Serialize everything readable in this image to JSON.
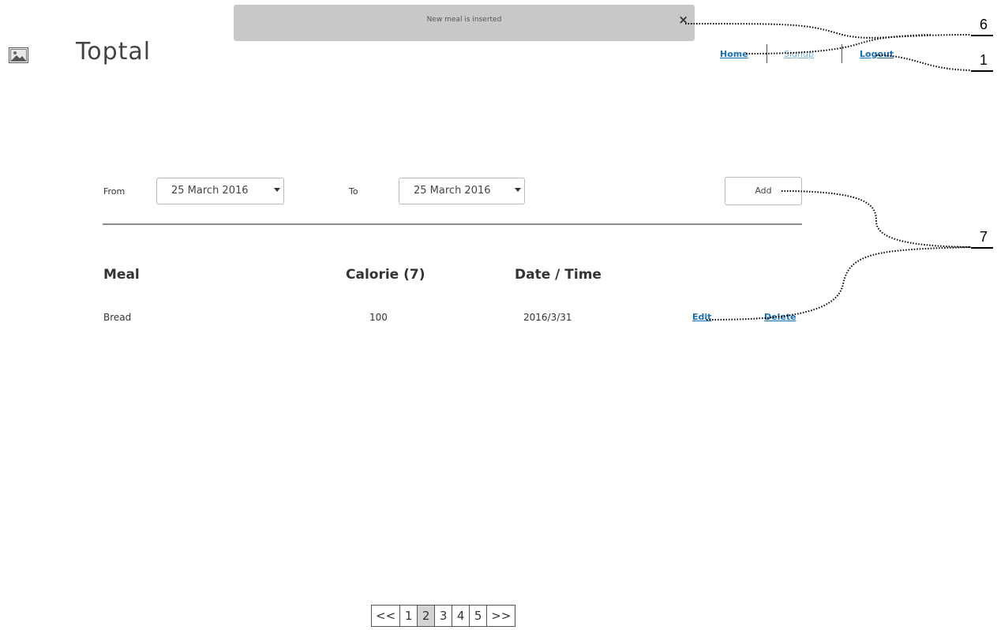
{
  "notification": {
    "text": "New meal is inserted",
    "close_symbol": "×"
  },
  "header": {
    "title": "Toptal",
    "logo_icon": "image-placeholder-icon"
  },
  "nav": {
    "home": "Home",
    "signup": "Signup",
    "logout": "Logout"
  },
  "filter": {
    "from_label": "From",
    "from_value": "25 March 2016",
    "to_label": "To",
    "to_value": "25 March 2016",
    "add_label": "Add"
  },
  "table": {
    "headers": {
      "meal": "Meal",
      "calorie": "Calorie (7)",
      "datetime": "Date / Time"
    },
    "rows": [
      {
        "meal": "Bread",
        "calorie": "100",
        "datetime": "2016/3/31",
        "edit": "Edit",
        "delete": "Delete"
      }
    ]
  },
  "pagination": {
    "prev": "<<",
    "pages": [
      "1",
      "2",
      "3",
      "4",
      "5"
    ],
    "next": ">>",
    "current": "2"
  },
  "annotations": {
    "a1": "6",
    "a2": "1",
    "a3": "7"
  },
  "colors": {
    "link": "#1a6fb0",
    "link_muted": "#7cb4dc",
    "toast_bg": "#c8c8c8"
  }
}
